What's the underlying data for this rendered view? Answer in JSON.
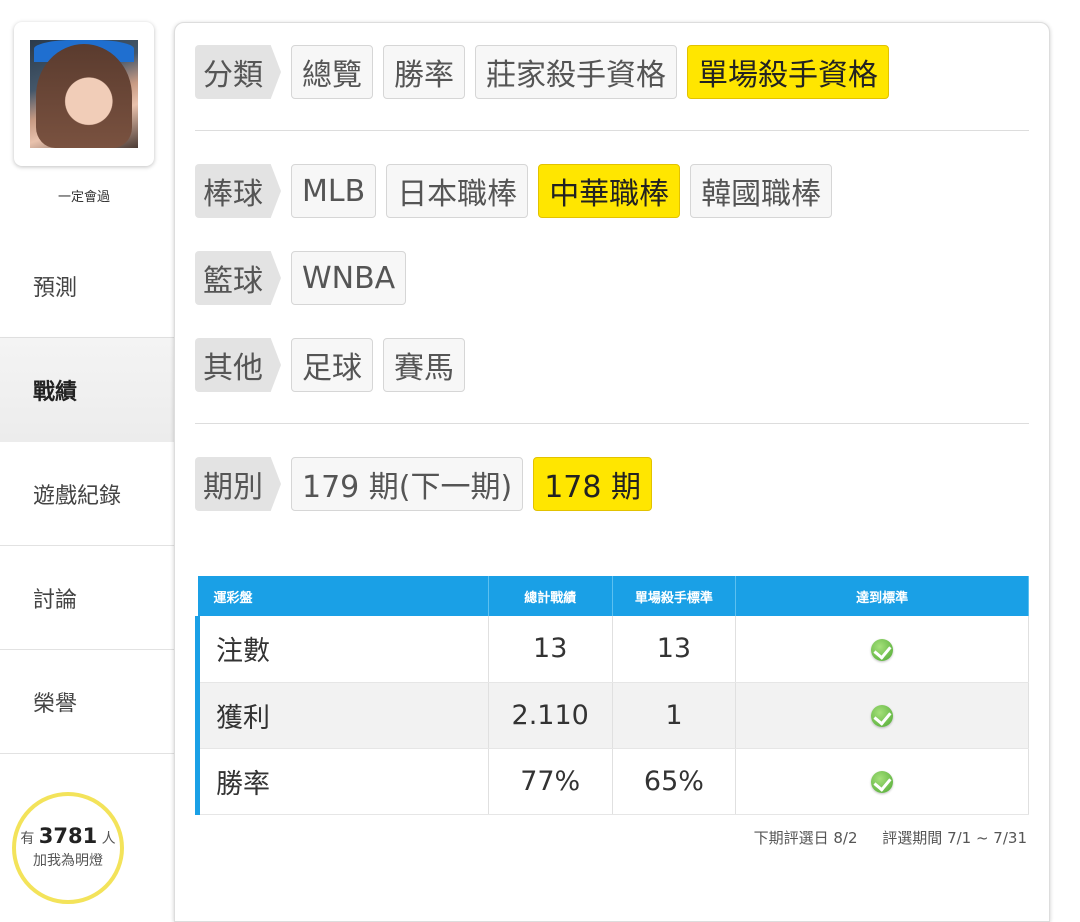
{
  "sidebar": {
    "username": "一定會過",
    "nav": [
      "預測",
      "戰績",
      "遊戲紀錄",
      "討論",
      "榮譽"
    ],
    "fans": {
      "prefix": "有",
      "count": "3781",
      "suffix": "人",
      "cta": "加我為明燈"
    }
  },
  "filters": {
    "category": {
      "label": "分類",
      "options": [
        "總覽",
        "勝率",
        "莊家殺手資格",
        "單場殺手資格"
      ],
      "selected": "單場殺手資格"
    },
    "baseball": {
      "label": "棒球",
      "options": [
        "MLB",
        "日本職棒",
        "中華職棒",
        "韓國職棒"
      ],
      "selected": "中華職棒"
    },
    "basketball": {
      "label": "籃球",
      "options": [
        "WNBA"
      ]
    },
    "other": {
      "label": "其他",
      "options": [
        "足球",
        "賽馬"
      ]
    },
    "period": {
      "label": "期別",
      "options": [
        "179 期(下一期)",
        "178 期"
      ],
      "selected": "178 期"
    }
  },
  "table": {
    "headers": [
      "運彩盤",
      "總計戰績",
      "單場殺手標準",
      "達到標準"
    ],
    "rows": [
      {
        "name": "注數",
        "total": "13",
        "standard": "13",
        "met_icon": "check-circle-icon"
      },
      {
        "name": "獲利",
        "total": "2.110",
        "standard": "1",
        "met_icon": "check-circle-icon"
      },
      {
        "name": "勝率",
        "total": "77%",
        "standard": "65%",
        "met_icon": "check-circle-icon"
      }
    ]
  },
  "footnote": {
    "next_eval": "下期評選日 8/2",
    "eval_period": "評選期間 7/1 ~ 7/31"
  },
  "colors": {
    "selected": "#ffe600",
    "table_header": "#1aa0e6",
    "check": "#4ea832",
    "fans_ring": "#f3e35a"
  }
}
